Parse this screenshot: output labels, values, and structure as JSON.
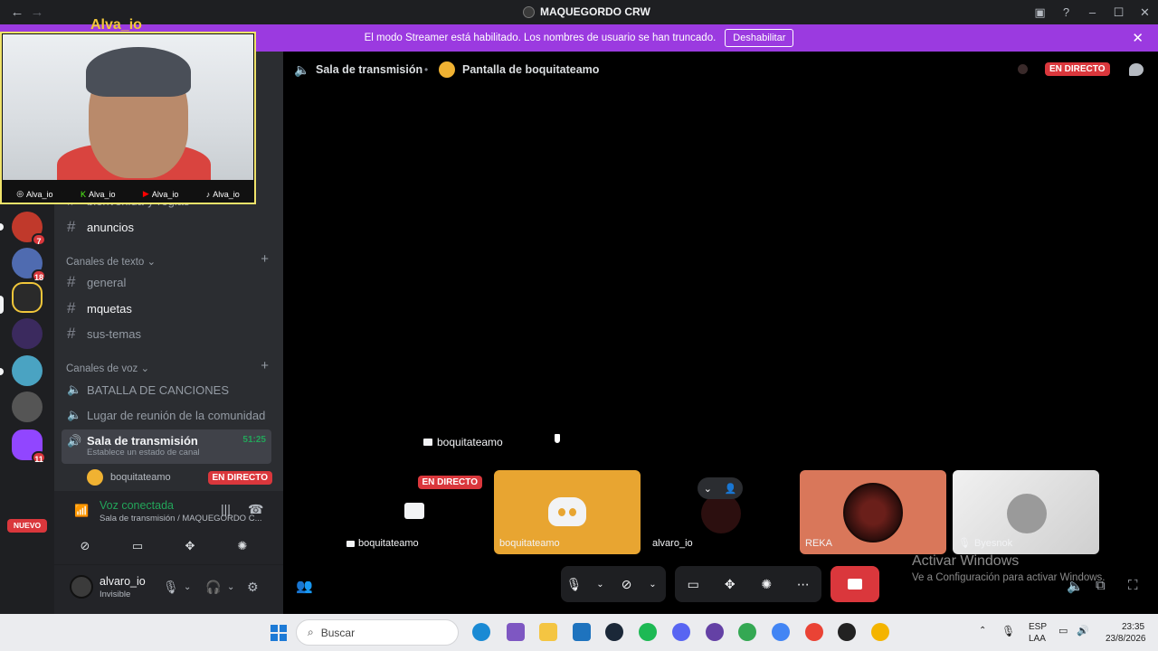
{
  "titlebar": {
    "server_name": "MAQUEGORDO CRW"
  },
  "banner": {
    "message": "El modo Streamer está habilitado. Los nombres de usuario se han truncado.",
    "button": "Deshabilitar"
  },
  "webcam": {
    "handle": "Alva_io",
    "socials": [
      {
        "icon": "instagram-icon",
        "glyph": "◎",
        "label": "Alva_io"
      },
      {
        "icon": "kick-icon",
        "glyph": "K",
        "label": "Alva_io"
      },
      {
        "icon": "youtube-icon",
        "glyph": "▶",
        "label": "Alva_io"
      },
      {
        "icon": "tiktok-icon",
        "glyph": "♪",
        "label": "Alva_io"
      }
    ]
  },
  "guilds": {
    "badges": [
      "7",
      "18",
      "11"
    ],
    "new_label": "NUEVO"
  },
  "sidebar": {
    "partial_channel": "bienvenida-y-reglas",
    "announce_channel": "anuncios",
    "text_category": "Canales de texto",
    "text_channels": [
      "general",
      "mquetas",
      "sus-temas"
    ],
    "voice_category": "Canales de voz",
    "voice_channels": [
      "BATALLA DE CANCIONES",
      "Lugar de reunión de la comunidad"
    ],
    "active_channel": {
      "name": "Sala de transmisión",
      "status_placeholder": "Establece un estado de canal",
      "timer": "51:25"
    },
    "stream_user": {
      "name": "boquitateamo",
      "badge": "EN DIRECTO"
    }
  },
  "voice_panel": {
    "status": "Voz conectada",
    "location": "Sala de transmisión / MAQUEGORDO C..."
  },
  "user_panel": {
    "name": "alvaro_io",
    "status": "Invisible"
  },
  "main": {
    "channel": "Sala de transmisión",
    "screen_share": "Pantalla de boquitateamo",
    "live_badge": "EN DIRECTO",
    "streamer_label": "boquitateamo"
  },
  "tiles": [
    {
      "name": "boquitateamo",
      "badge": "EN DIRECTO",
      "color": "#000000"
    },
    {
      "name": "boquitateamo",
      "color": "#e8a531"
    },
    {
      "name": "alvaro_io",
      "color": "#000000"
    },
    {
      "name": "REKA",
      "color": "#d9775a"
    },
    {
      "name": "Byesnok",
      "color": "#e4e4e4"
    }
  ],
  "watermark": {
    "title": "Activar Windows",
    "subtitle": "Ve a Configuración para activar Windows."
  },
  "taskbar": {
    "search_placeholder": "Buscar",
    "lang_top": "ESP",
    "lang_bottom": "LAA",
    "time": "23:35",
    "date": "23/8/2026"
  },
  "colors": {
    "accent_purple": "#9b3ae0",
    "live_red": "#da373c",
    "voice_green": "#23a55a"
  }
}
